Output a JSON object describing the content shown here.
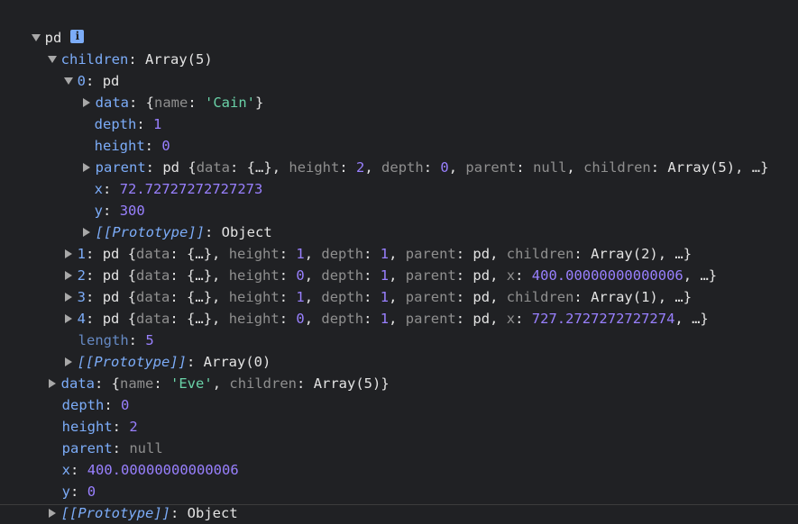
{
  "root": {
    "label": "pd",
    "info_icon": "i"
  },
  "children": {
    "key": "children",
    "value": "Array(5)",
    "item0": {
      "index": "0",
      "type": "pd",
      "data_key": "data",
      "data_open": "{",
      "data_name_key": "name",
      "data_name_value": "'Cain'",
      "data_close": "}",
      "depth_key": "depth",
      "depth_value": "1",
      "height_key": "height",
      "height_value": "0",
      "parent_key": "parent",
      "parent_type": "pd",
      "parent_data_key": "data",
      "parent_data_value": "{…}",
      "parent_height_key": "height",
      "parent_height_value": "2",
      "parent_depth_key": "depth",
      "parent_depth_value": "0",
      "parent_parent_key": "parent",
      "parent_parent_value": "null",
      "parent_children_key": "children",
      "parent_children_value": "Array(5)",
      "ellipsis": "…}",
      "x_key": "x",
      "x_value": "72.72727272727273",
      "y_key": "y",
      "y_value": "300",
      "proto_label": "[[Prototype]]",
      "proto_value": "Object"
    },
    "item1": {
      "index": "1",
      "type": "pd",
      "data_key": "data",
      "data_value": "{…}",
      "height_key": "height",
      "height_value": "1",
      "depth_key": "depth",
      "depth_value": "1",
      "parent_key": "parent",
      "parent_value": "pd",
      "last_key": "children",
      "last_value": "Array(2)",
      "ellipsis": "…}"
    },
    "item2": {
      "index": "2",
      "type": "pd",
      "data_key": "data",
      "data_value": "{…}",
      "height_key": "height",
      "height_value": "0",
      "depth_key": "depth",
      "depth_value": "1",
      "parent_key": "parent",
      "parent_value": "pd",
      "last_key": "x",
      "last_value": "400.00000000000006",
      "ellipsis": "…}"
    },
    "item3": {
      "index": "3",
      "type": "pd",
      "data_key": "data",
      "data_value": "{…}",
      "height_key": "height",
      "height_value": "1",
      "depth_key": "depth",
      "depth_value": "1",
      "parent_key": "parent",
      "parent_value": "pd",
      "last_key": "children",
      "last_value": "Array(1)",
      "ellipsis": "…}"
    },
    "item4": {
      "index": "4",
      "type": "pd",
      "data_key": "data",
      "data_value": "{…}",
      "height_key": "height",
      "height_value": "0",
      "depth_key": "depth",
      "depth_value": "1",
      "parent_key": "parent",
      "parent_value": "pd",
      "last_key": "x",
      "last_value": "727.2727272727274",
      "ellipsis": "…}"
    },
    "length_key": "length",
    "length_value": "5",
    "proto_label": "[[Prototype]]",
    "proto_value": "Array(0)"
  },
  "data": {
    "key": "data",
    "open": "{",
    "name_key": "name",
    "name_value": "'Eve'",
    "children_key": "children",
    "children_value": "Array(5)",
    "close": "}"
  },
  "depth": {
    "key": "depth",
    "value": "0"
  },
  "height": {
    "key": "height",
    "value": "2"
  },
  "parent": {
    "key": "parent",
    "value": "null"
  },
  "x": {
    "key": "x",
    "value": "400.00000000000006"
  },
  "y": {
    "key": "y",
    "value": "0"
  },
  "proto": {
    "label": "[[Prototype]]",
    "value": "Object"
  }
}
